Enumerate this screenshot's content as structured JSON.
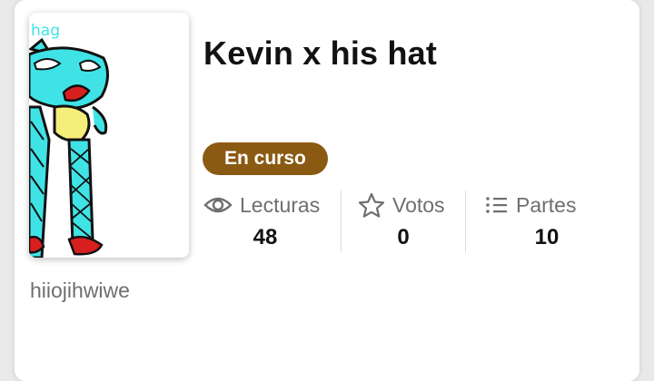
{
  "story": {
    "title": "Kevin x his hat",
    "status": "En curso",
    "author": "hiiojihwiwe",
    "cover_text": "hag"
  },
  "stats": {
    "reads": {
      "label": "Lecturas",
      "value": "48",
      "icon": "eye-icon"
    },
    "votes": {
      "label": "Votos",
      "value": "0",
      "icon": "star-icon"
    },
    "parts": {
      "label": "Partes",
      "value": "10",
      "icon": "list-icon"
    }
  },
  "colors": {
    "status_badge": "#8a5a12",
    "cover_character": "#3fe3e6",
    "cover_belly": "#f6ee7a",
    "cover_feet": "#d81f1f"
  }
}
